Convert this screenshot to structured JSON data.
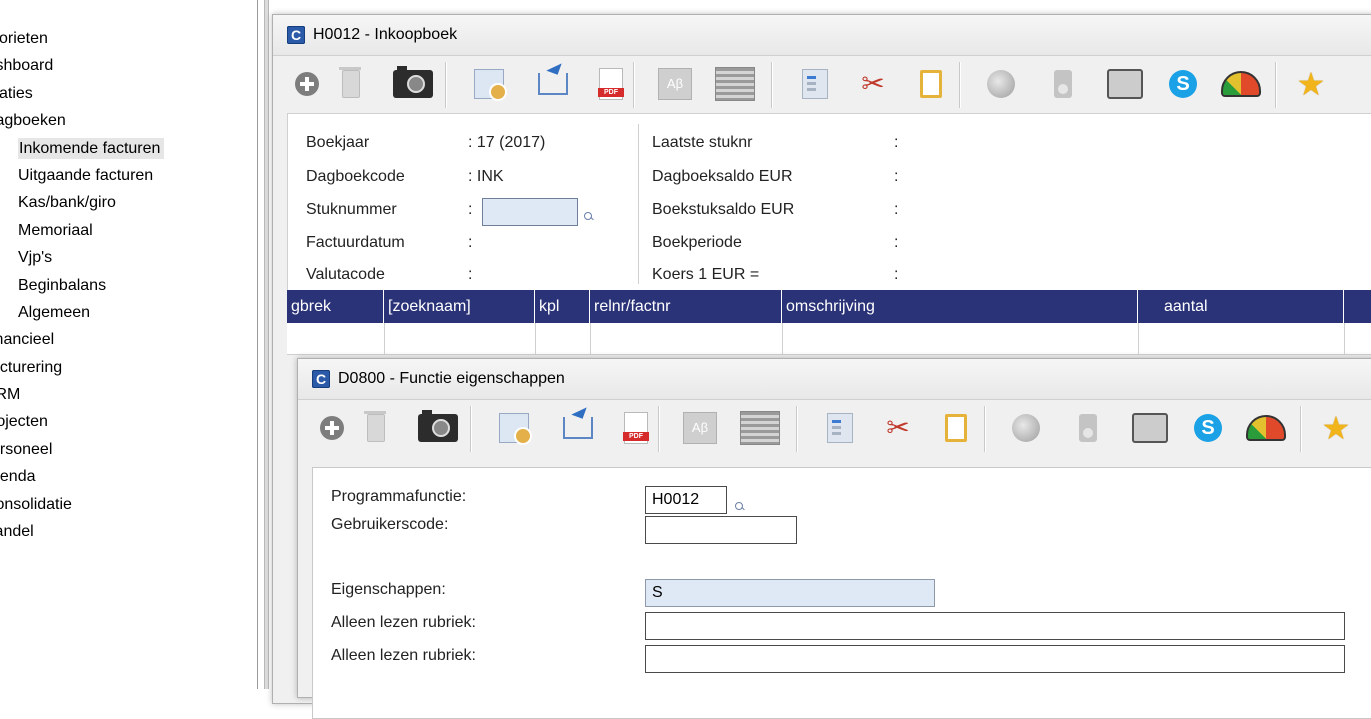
{
  "nav": {
    "items": [
      {
        "label": "vorieten",
        "level": "top"
      },
      {
        "label": "ıshboard",
        "level": "top"
      },
      {
        "label": "ılaties",
        "level": "top"
      },
      {
        "label": "ıagboeken",
        "level": "top"
      },
      {
        "label": "Inkomende facturen",
        "level": "sub",
        "selected": true
      },
      {
        "label": "Uitgaande facturen",
        "level": "sub"
      },
      {
        "label": "Kas/bank/giro",
        "level": "sub"
      },
      {
        "label": "Memoriaal",
        "level": "sub"
      },
      {
        "label": "Vjp's",
        "level": "sub"
      },
      {
        "label": "Beginbalans",
        "level": "sub"
      },
      {
        "label": "Algemeen",
        "level": "sub"
      },
      {
        "label": "inancieel",
        "level": "top"
      },
      {
        "label": "acturering",
        "level": "top"
      },
      {
        "label": ":RM",
        "level": "top"
      },
      {
        "label": "rojecten",
        "level": "top"
      },
      {
        "label": "ersoneel",
        "level": "top"
      },
      {
        "label": "genda",
        "level": "top"
      },
      {
        "label": ":onsolidatie",
        "level": "top"
      },
      {
        "label": "landel",
        "level": "top"
      }
    ]
  },
  "window_main": {
    "app_icon": "C",
    "title": "H0012 - Inkoopboek",
    "form_left": {
      "boekjaar": {
        "label": "Boekjaar",
        "value": ": 17 (2017)"
      },
      "dagboekcode": {
        "label": "Dagboekcode",
        "value": ": INK"
      },
      "stuknummer": {
        "label": "Stuknummer",
        "value": ":"
      },
      "factuurdatum": {
        "label": "Factuurdatum",
        "value": ":"
      },
      "valutacode": {
        "label": "Valutacode",
        "value": ":"
      }
    },
    "form_right": {
      "laatste": {
        "label": "Laatste stuknr",
        "value": ":"
      },
      "dagboeksaldo": {
        "label": "Dagboeksaldo  EUR",
        "value": ":"
      },
      "boekstuksaldo": {
        "label": "Boekstuksaldo EUR",
        "value": ":"
      },
      "boekperiode": {
        "label": "Boekperiode",
        "value": ":"
      },
      "koers": {
        "label": "Koers 1 EUR =",
        "value": ":"
      }
    },
    "grid_columns": [
      "gbrek",
      "[zoeknaam]",
      "kpl",
      "relnr/factnr",
      "omschrijving",
      "aantal"
    ]
  },
  "window_dialog": {
    "app_icon": "C",
    "title": "D0800 - Functie eigenschappen",
    "programmafunctie": {
      "label": "Programmafunctie:",
      "value": "H0012"
    },
    "gebruikerscode": {
      "label": "Gebruikerscode:",
      "value": ""
    },
    "eigenschappen": {
      "label": "Eigenschappen:",
      "value": "S"
    },
    "alleen_lezen_1": {
      "label": "Alleen lezen rubriek:",
      "value": ""
    },
    "alleen_lezen_2": {
      "label": "Alleen lezen rubriek:",
      "value": ""
    }
  },
  "toolbar_icons": [
    "add-icon",
    "trash-icon",
    "camera-icon",
    "preview-icon",
    "share-icon",
    "pdf-icon",
    "font-icon",
    "calculator-icon",
    "document-icon",
    "scissors-icon",
    "clipboard-icon",
    "globe-icon",
    "device-icon",
    "screen-icon",
    "skype-icon",
    "gauge-icon",
    "star-icon"
  ],
  "colors": {
    "grid_header": "#2b3378",
    "input_highlight": "#dfe8f5",
    "app_icon": "#2a5aa8"
  }
}
